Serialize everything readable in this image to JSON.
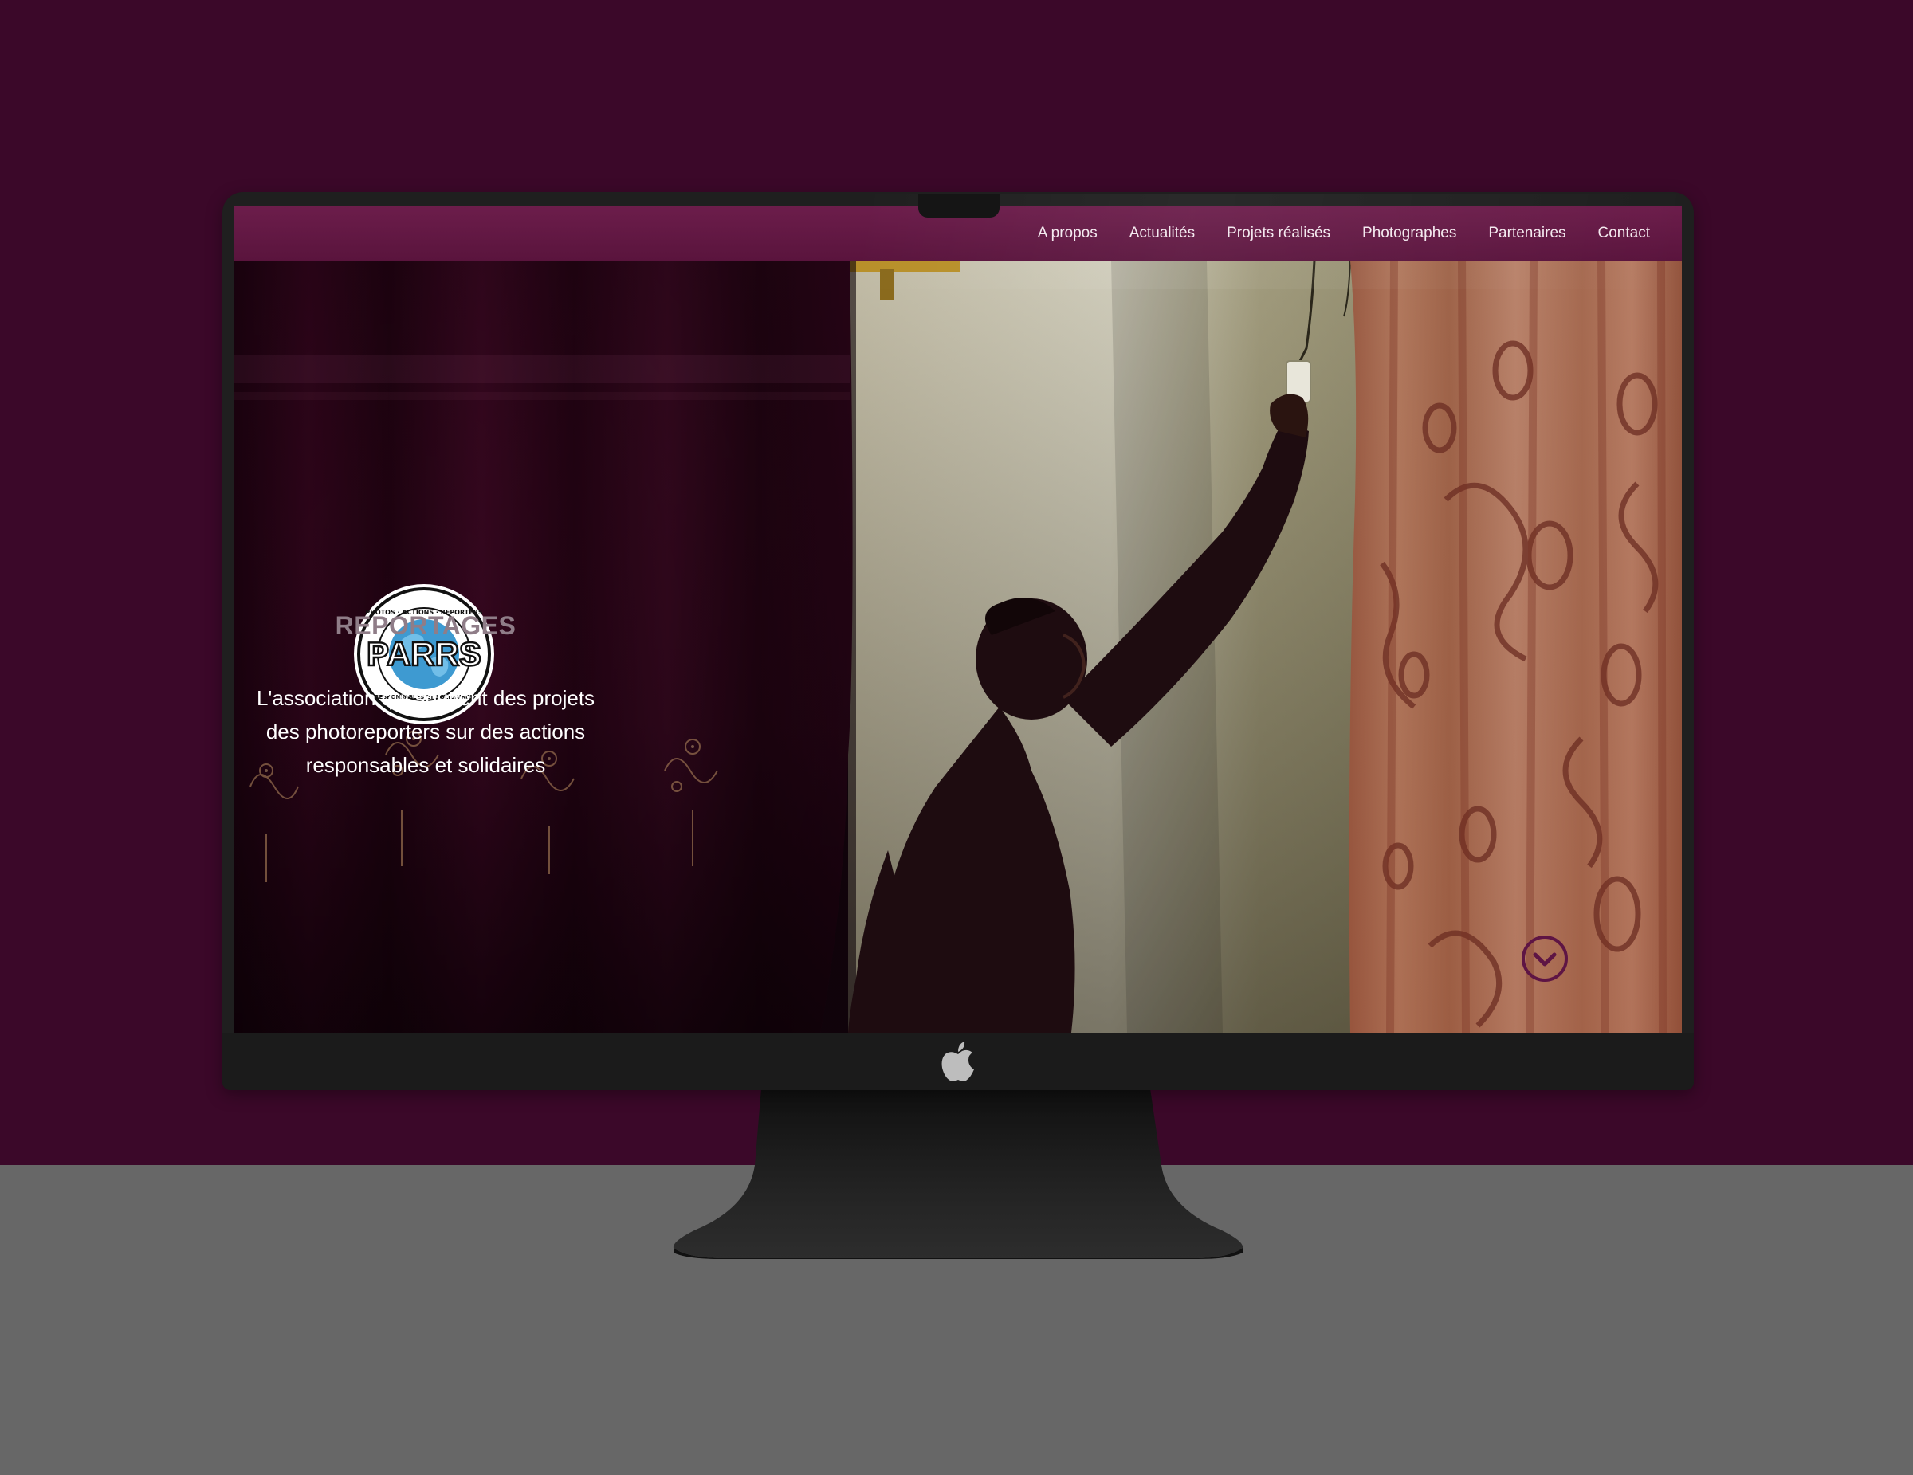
{
  "nav": {
    "items": [
      {
        "label": "A propos"
      },
      {
        "label": "Actualités"
      },
      {
        "label": "Projets réalisés"
      },
      {
        "label": "Photographes"
      },
      {
        "label": "Partenaires"
      },
      {
        "label": "Contact"
      }
    ]
  },
  "logo": {
    "text": "PARRS",
    "ring_text_top": "PHOTOS · ACTIONS · REPORTERS",
    "ring_text_bottom": "RESPONSABLES ET SOLIDAIRES"
  },
  "hero": {
    "title": "REPORTAGES",
    "tagline": "L'association qui soutient des projets des photoreporters sur des actions responsables et solidaires"
  },
  "icons": {
    "scroll": "chevron-down-circle-icon",
    "device": "apple-logo-icon"
  },
  "colors": {
    "background": "#3b0829",
    "floor": "#676767",
    "nav_bar": "#6c1d4b",
    "accent": "#5e1544",
    "title_gray": "#8f7d88"
  }
}
